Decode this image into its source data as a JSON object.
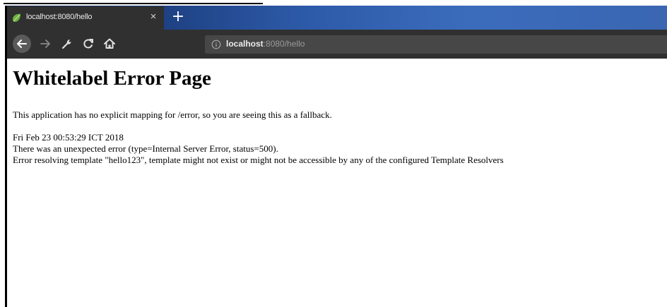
{
  "tab": {
    "title": "localhost:8080/hello",
    "close_glyph": "×",
    "new_tab_glyph": "+"
  },
  "toolbar": {
    "url_host": "localhost",
    "url_rest": ":8080/hello"
  },
  "icons": {
    "favicon": "spring-leaf-icon",
    "back": "arrow-left-icon",
    "forward": "arrow-right-icon",
    "extension": "wrench-icon",
    "reload": "reload-icon",
    "home": "home-icon",
    "site_info": "info-icon"
  },
  "colors": {
    "tab_bg": "#303030",
    "toolbar_bg": "#303030",
    "urlbar_bg": "#474747",
    "tabbar_gradient_start": "#10204a",
    "tabbar_gradient_end": "#3a66b2",
    "favicon_green": "#6db33f"
  },
  "page": {
    "heading": "Whitelabel Error Page",
    "intro": "This application has no explicit mapping for /error, so you are seeing this as a fallback.",
    "timestamp": "Fri Feb 23 00:53:29 ICT 2018",
    "error_line": "There was an unexpected error (type=Internal Server Error, status=500).",
    "error_detail": "Error resolving template \"hello123\", template might not exist or might not be accessible by any of the configured Template Resolvers"
  }
}
